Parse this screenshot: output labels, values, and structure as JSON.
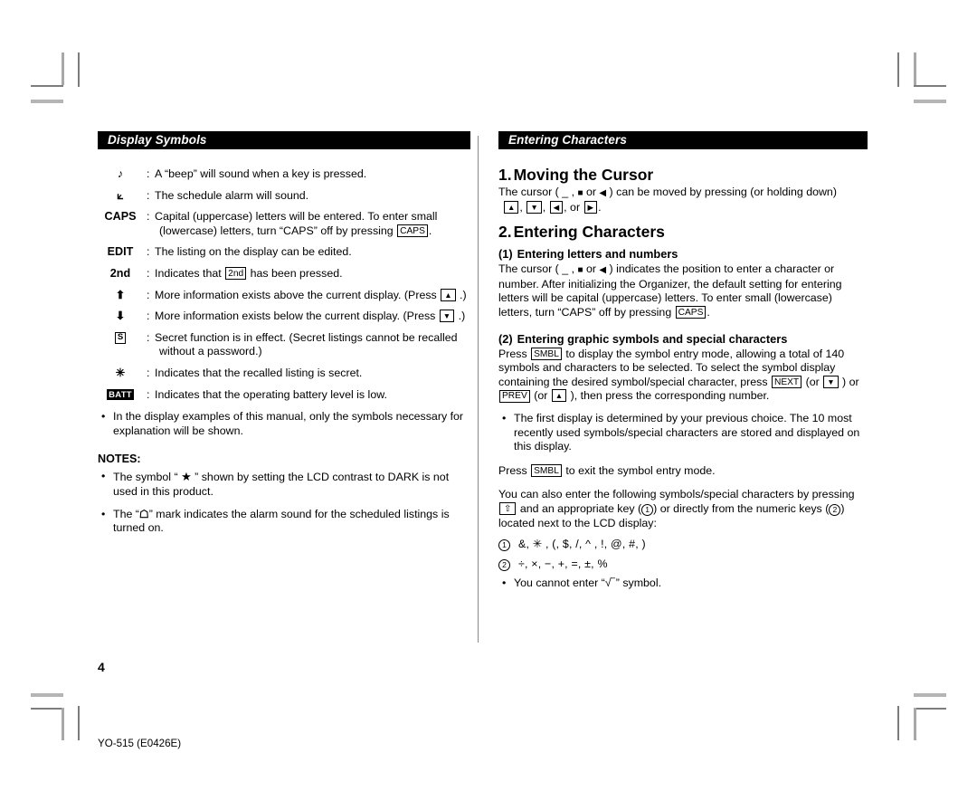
{
  "document": {
    "page_number": "4",
    "footer_code": "YO-515 (E0426E)"
  },
  "left_column": {
    "banner": "Display Symbols",
    "symbols": [
      {
        "glyph": "note-icon",
        "glyph_text": "♪",
        "description": "A “beep” will sound when a key is pressed."
      },
      {
        "glyph": "alarm-bell-icon",
        "glyph_text": "⟀",
        "description": "The schedule alarm will sound."
      },
      {
        "glyph": "caps-label",
        "glyph_text": "CAPS",
        "description": "Capital (uppercase) letters will be entered. To enter small",
        "description_line2_a": "(lowercase) letters, turn “CAPS” off by pressing ",
        "description_line2_key": "CAPS",
        "description_line2_b": "."
      },
      {
        "glyph": "edit-label",
        "glyph_text": "EDIT",
        "description": "The listing on the display can be edited."
      },
      {
        "glyph": "second-label",
        "glyph_text": "2nd",
        "description_a": "Indicates that ",
        "description_key": "2nd",
        "description_b": " has been pressed."
      },
      {
        "glyph": "arrow-up-icon",
        "glyph_text": "⬆",
        "description_a": "More information exists above the current display. (Press ",
        "description_key": "▲",
        "description_b": " .)"
      },
      {
        "glyph": "arrow-down-icon",
        "glyph_text": "⬇",
        "description_a": "More information exists below the current display. (Press ",
        "description_key": "▼",
        "description_b": " .)"
      },
      {
        "glyph": "secret-s-icon",
        "glyph_text": "S",
        "description": "Secret function is in effect. (Secret listings cannot be recalled",
        "description_line2": "without a password.)"
      },
      {
        "glyph": "asterisk-icon",
        "glyph_text": "✳",
        "description": "Indicates that the recalled listing is secret."
      },
      {
        "glyph": "battery-low-icon",
        "glyph_text": "BATT",
        "description": "Indicates that the operating battery level is low."
      }
    ],
    "bullet_display_examples": "In the display examples of this manual, only the symbols necessary for explanation will be shown.",
    "notes_heading": "NOTES:",
    "notes": [
      {
        "text_a": "The symbol “ ",
        "glyph": "★",
        "text_b": " ” shown by setting the LCD contrast to DARK is not used in this product."
      },
      {
        "text_a": "The “",
        "glyph": "☖",
        "text_b": "” mark indicates the alarm sound for the scheduled listings is turned on."
      }
    ]
  },
  "right_column": {
    "banner": "Entering Characters",
    "section1": {
      "number": "1.",
      "title": "Moving the Cursor",
      "para_a": "The cursor ( _ , ",
      "para_cursor_block": "■",
      "para_b": " or ",
      "para_cursor_arrow": "◀",
      "para_c": " ) can be moved by pressing (or holding down)",
      "keys": [
        "▲",
        "▼",
        "◀",
        "▶"
      ],
      "keys_sep1": ", ",
      "keys_sep2": ", ",
      "keys_sep3": ", or ",
      "keys_end": "."
    },
    "section2": {
      "number": "2.",
      "title": "Entering Characters",
      "sub1": {
        "number": "(1)",
        "title": "Entering letters and numbers",
        "para_a": "The cursor ( _ , ",
        "para_block": "■",
        "para_b": " or ",
        "para_arrow": "◀",
        "para_c": " ) indicates the position to enter a character or number. After initializing the Organizer, the default setting for entering letters will be capital (uppercase) letters. To enter small (lowercase) letters, turn “CAPS” off by pressing ",
        "para_key": "CAPS",
        "para_d": "."
      },
      "sub2": {
        "number": "(2)",
        "title": "Entering graphic symbols and special characters",
        "para1_a": "Press ",
        "para1_key": "SMBL",
        "para1_b": " to display the symbol entry mode, allowing a total of 140 symbols and characters to be selected. To select the symbol display containing the desired symbol/special character, press ",
        "para1_key2": "NEXT",
        "para1_c": " (or ",
        "para1_key3": "▼",
        "para1_d": " ) or ",
        "para1_key4": "PREV",
        "para1_e": " (or ",
        "para1_key5": "▲",
        "para1_f": " ), then press the corresponding number.",
        "bullet": "The first display is determined by your previous choice. The 10 most recently used symbols/special characters are stored and displayed on this display.",
        "para2_a": "Press ",
        "para2_key": "SMBL",
        "para2_b": " to exit the symbol entry mode.",
        "para3_a": "You can also enter the following symbols/special characters by pressing ",
        "para3_key": "⇧",
        "para3_b": " and an appropriate key (",
        "para3_circ1": "1",
        "para3_c": ") or directly from the numeric keys (",
        "para3_circ2": "2",
        "para3_d": ") located next to the LCD display:",
        "list": [
          {
            "label": "1",
            "items": "&, ✳ , (, $, /, ^ , !, @, #, )"
          },
          {
            "label": "2",
            "items": "÷, ×, −, +, =, ±, %"
          }
        ],
        "final_bullet_a": "You cannot enter “",
        "final_bullet_sqrt": "√‾",
        "final_bullet_b": "” symbol."
      }
    }
  }
}
